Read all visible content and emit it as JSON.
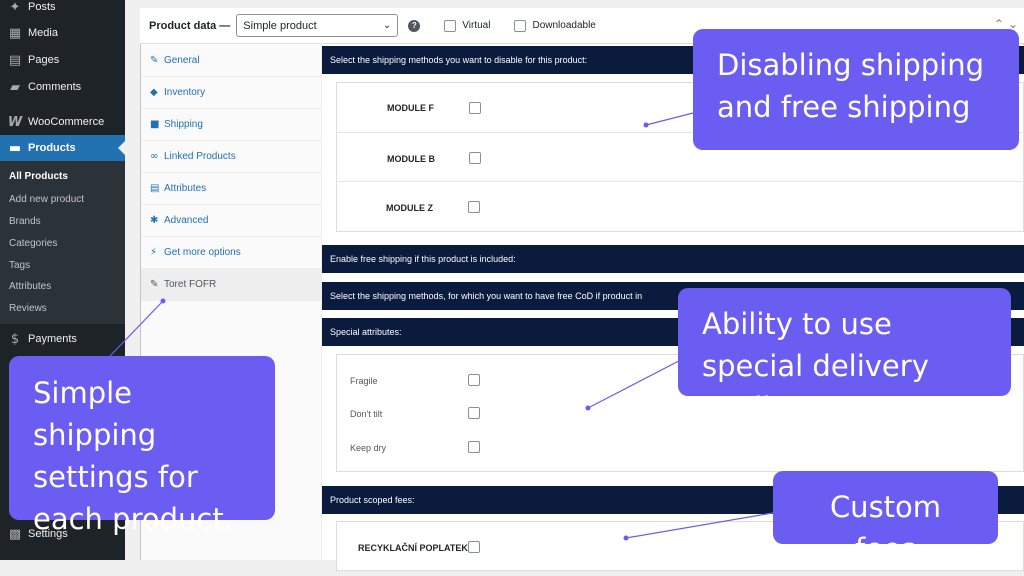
{
  "sidebar": {
    "items": [
      {
        "label": "Posts",
        "icon": "pin-icon"
      },
      {
        "label": "Media",
        "icon": "media-icon"
      },
      {
        "label": "Pages",
        "icon": "pages-icon"
      },
      {
        "label": "Comments",
        "icon": "comments-icon"
      },
      {
        "label": "WooCommerce",
        "icon": "woocommerce-icon"
      },
      {
        "label": "Products",
        "icon": "products-icon"
      }
    ],
    "submenu": [
      "All Products",
      "Add new product",
      "Brands",
      "Categories",
      "Tags",
      "Attributes",
      "Reviews"
    ],
    "payments": "Payments",
    "settings": "Settings"
  },
  "product_data": {
    "title": "Product data —",
    "type_value": "Simple product",
    "virtual_label": "Virtual",
    "downloadable_label": "Downloadable"
  },
  "tabs": [
    {
      "label": "General",
      "icon": "wrench-icon"
    },
    {
      "label": "Inventory",
      "icon": "tag-icon"
    },
    {
      "label": "Shipping",
      "icon": "truck-icon"
    },
    {
      "label": "Linked Products",
      "icon": "link-icon"
    },
    {
      "label": "Attributes",
      "icon": "list-icon"
    },
    {
      "label": "Advanced",
      "icon": "gear-icon"
    },
    {
      "label": "Get more options",
      "icon": "plug-icon"
    },
    {
      "label": "Toret FOFR",
      "icon": "wrench-icon"
    }
  ],
  "sections": {
    "disable_shipping": "Select the shipping methods you want to disable for this product:",
    "modules": [
      "MODULE F",
      "MODULE B",
      "MODULE Z"
    ],
    "free_shipping": "Enable free shipping if this product is included:",
    "free_cod": "Select the shipping methods, for which you want to have free CoD if product in",
    "special_attributes": "Special attributes:",
    "attributes": [
      "Fragile",
      "Don't tilt",
      "Keep dry"
    ],
    "scoped_fees": "Product scoped fees:",
    "fee_label": "RECYKLAČNÍ POPLATEK"
  },
  "callouts": {
    "disabling": "Disabling shipping and free shipping",
    "special": "Ability to use special delivery attributes",
    "simple": "Simple shipping settings for each product.",
    "fees": "Custom fees"
  },
  "colors": {
    "sidebar": "#1d2327",
    "active_menu": "#2271b1",
    "section_bar": "#0a1b3d",
    "callout": "#6b5cf2"
  }
}
